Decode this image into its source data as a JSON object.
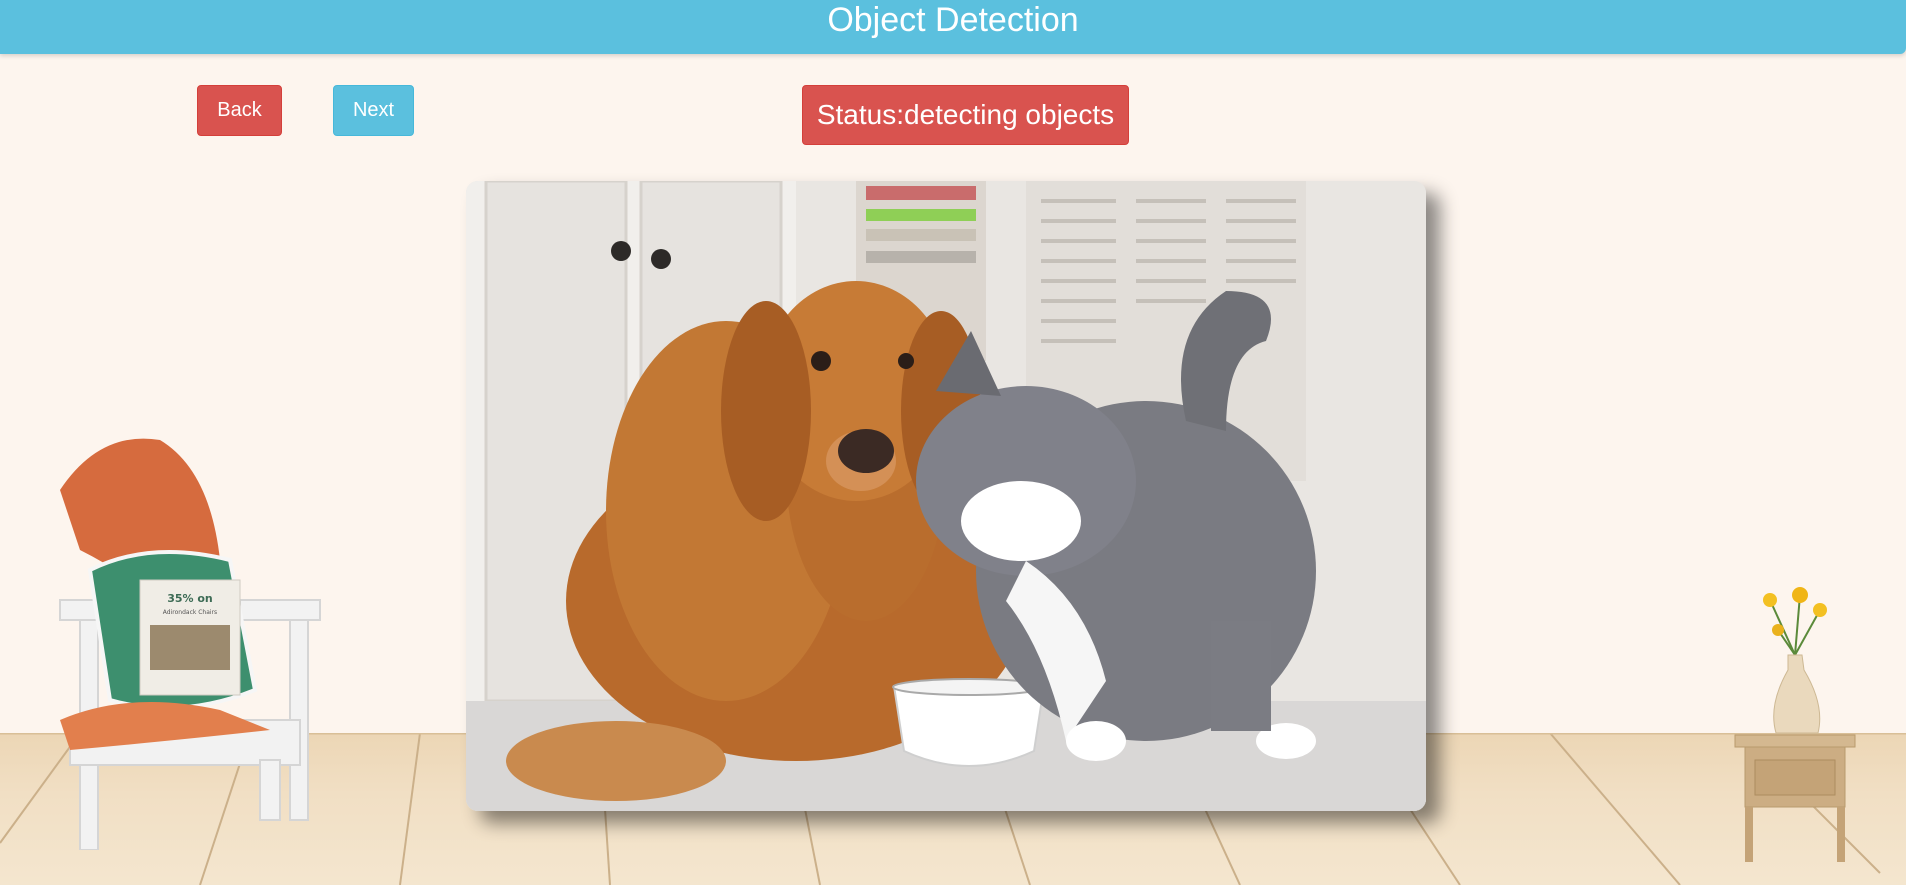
{
  "header": {
    "title": "Object Detection"
  },
  "controls": {
    "back_label": "Back",
    "next_label": "Next",
    "status_text": "Status:detecting objects"
  },
  "photo_pillow_text": {
    "line1": "35% on",
    "line2": "Adirondack Chairs"
  },
  "colors": {
    "header": "#5bc0de",
    "back_button": "#d9534f",
    "next_button": "#5bc0de",
    "status": "#d9534f",
    "background": "#fdf5ee"
  }
}
